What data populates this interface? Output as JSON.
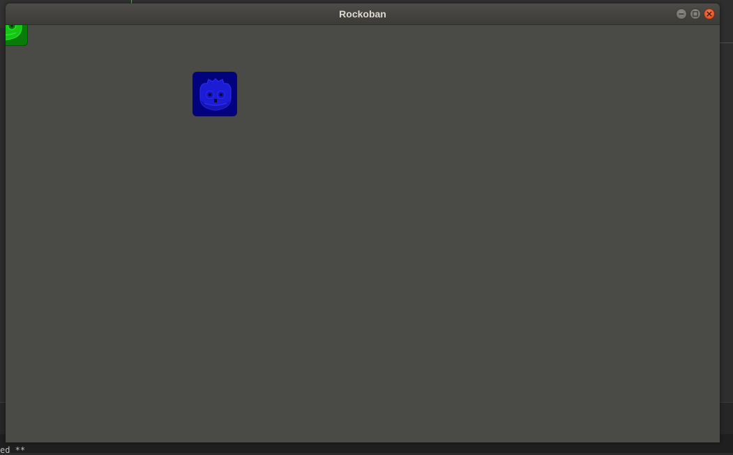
{
  "window": {
    "title": "Rockoban",
    "buttons": {
      "minimize": "minimize-icon",
      "maximize": "maximize-icon",
      "close": "close-icon"
    },
    "background_color": "#4a4a47"
  },
  "game": {
    "sprites": [
      {
        "name": "player-sprite",
        "icon": "godot-robot-icon",
        "color": "#02027e"
      },
      {
        "name": "goal-sprite",
        "icon": "godot-robot-icon",
        "color": "#0a7a0a"
      }
    ]
  },
  "terminal": {
    "text": "ed **"
  }
}
